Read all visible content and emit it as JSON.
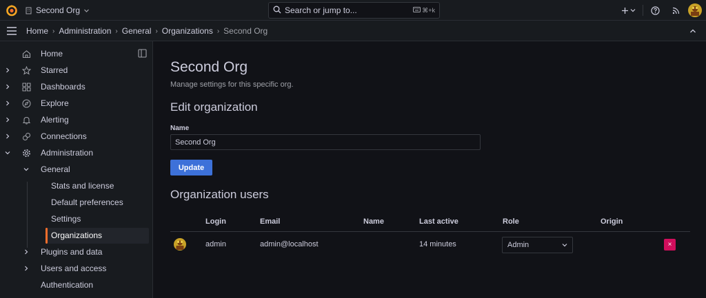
{
  "colors": {
    "accent_orange": "#f76e2b",
    "primary_blue": "#3d71d9",
    "danger": "#d10e5c",
    "background": "#111217",
    "panel": "#181b1f"
  },
  "topbar": {
    "logo_icon": "grafana-logo-icon",
    "org_name": "Second Org",
    "search_placeholder": "Search or jump to...",
    "search_shortcut": "⌘+k",
    "icons": [
      "plus-icon",
      "chevron-down-icon",
      "help-icon",
      "rss-icon",
      "avatar"
    ]
  },
  "breadcrumb": {
    "items": [
      "Home",
      "Administration",
      "General",
      "Organizations",
      "Second Org"
    ]
  },
  "sidebar": {
    "items": [
      {
        "label": "Home",
        "icon": "home-icon"
      },
      {
        "label": "Starred",
        "icon": "star-icon"
      },
      {
        "label": "Dashboards",
        "icon": "grid-icon"
      },
      {
        "label": "Explore",
        "icon": "compass-icon"
      },
      {
        "label": "Alerting",
        "icon": "bell-icon"
      },
      {
        "label": "Connections",
        "icon": "link-icon"
      },
      {
        "label": "Administration",
        "icon": "gear-icon"
      },
      {
        "label": "General"
      },
      {
        "label": "Stats and license"
      },
      {
        "label": "Default preferences"
      },
      {
        "label": "Settings"
      },
      {
        "label": "Organizations"
      },
      {
        "label": "Plugins and data"
      },
      {
        "label": "Users and access"
      },
      {
        "label": "Authentication"
      }
    ]
  },
  "main": {
    "title": "Second Org",
    "subtitle": "Manage settings for this specific org.",
    "edit_section": "Edit organization",
    "name_label": "Name",
    "name_value": "Second Org",
    "update_button": "Update",
    "users_section": "Organization users",
    "table": {
      "columns": [
        "Login",
        "Email",
        "Name",
        "Last active",
        "Role",
        "Origin"
      ],
      "rows": [
        {
          "login": "admin",
          "email": "admin@localhost",
          "name": "",
          "last_active": "14 minutes",
          "role": "Admin",
          "origin": ""
        }
      ]
    },
    "delete_glyph": "×"
  }
}
